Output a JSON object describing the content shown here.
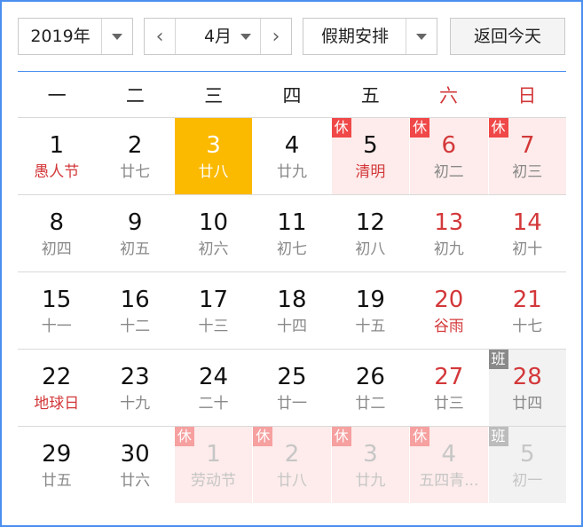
{
  "toolbar": {
    "year_select": "2019年",
    "prev_month": "‹",
    "month_select": "4月",
    "next_month": "›",
    "holiday_select": "假期安排",
    "today_button": "返回今天"
  },
  "weekdays": [
    "一",
    "二",
    "三",
    "四",
    "五",
    "六",
    "日"
  ],
  "badge_labels": {
    "rest": "休",
    "work": "班"
  },
  "weeks": [
    [
      {
        "day": "1",
        "lunar": "愚人节",
        "fest": true
      },
      {
        "day": "2",
        "lunar": "廿七"
      },
      {
        "day": "3",
        "lunar": "廿八",
        "today": true
      },
      {
        "day": "4",
        "lunar": "廿九"
      },
      {
        "day": "5",
        "lunar": "清明",
        "fest": true,
        "holiday": true,
        "badge": "rest"
      },
      {
        "day": "6",
        "lunar": "初二",
        "weekend": true,
        "holiday": true,
        "badge": "rest"
      },
      {
        "day": "7",
        "lunar": "初三",
        "weekend": true,
        "holiday": true,
        "badge": "rest"
      }
    ],
    [
      {
        "day": "8",
        "lunar": "初四"
      },
      {
        "day": "9",
        "lunar": "初五"
      },
      {
        "day": "10",
        "lunar": "初六"
      },
      {
        "day": "11",
        "lunar": "初七"
      },
      {
        "day": "12",
        "lunar": "初八"
      },
      {
        "day": "13",
        "lunar": "初九",
        "weekend": true
      },
      {
        "day": "14",
        "lunar": "初十",
        "weekend": true
      }
    ],
    [
      {
        "day": "15",
        "lunar": "十一"
      },
      {
        "day": "16",
        "lunar": "十二"
      },
      {
        "day": "17",
        "lunar": "十三"
      },
      {
        "day": "18",
        "lunar": "十四"
      },
      {
        "day": "19",
        "lunar": "十五"
      },
      {
        "day": "20",
        "lunar": "谷雨",
        "weekend": true,
        "fest": true
      },
      {
        "day": "21",
        "lunar": "十七",
        "weekend": true
      }
    ],
    [
      {
        "day": "22",
        "lunar": "地球日",
        "fest": true
      },
      {
        "day": "23",
        "lunar": "十九"
      },
      {
        "day": "24",
        "lunar": "二十"
      },
      {
        "day": "25",
        "lunar": "廿一"
      },
      {
        "day": "26",
        "lunar": "廿二"
      },
      {
        "day": "27",
        "lunar": "廿三",
        "weekend": true
      },
      {
        "day": "28",
        "lunar": "廿四",
        "weekend": true,
        "workday": true,
        "badge": "work"
      }
    ],
    [
      {
        "day": "29",
        "lunar": "廿五"
      },
      {
        "day": "30",
        "lunar": "廿六"
      },
      {
        "day": "1",
        "lunar": "劳动节",
        "other": true,
        "holiday": true,
        "badge": "rest"
      },
      {
        "day": "2",
        "lunar": "廿八",
        "other": true,
        "holiday": true,
        "badge": "rest"
      },
      {
        "day": "3",
        "lunar": "廿九",
        "other": true,
        "holiday": true,
        "badge": "rest"
      },
      {
        "day": "4",
        "lunar": "五四青...",
        "other": true,
        "holiday": true,
        "badge": "rest"
      },
      {
        "day": "5",
        "lunar": "初一",
        "other": true,
        "workday": true,
        "badge": "work"
      }
    ]
  ]
}
